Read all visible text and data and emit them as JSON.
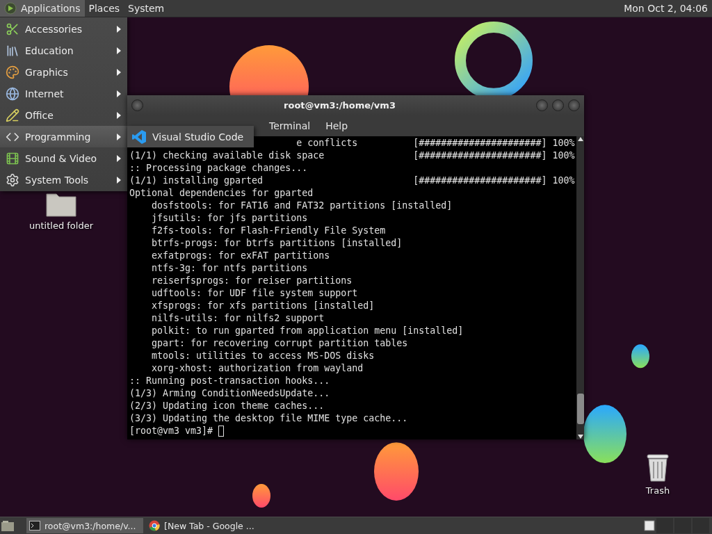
{
  "top_panel": {
    "menus": [
      {
        "label": "Applications",
        "selected": true
      },
      {
        "label": "Places",
        "selected": false
      },
      {
        "label": "System",
        "selected": false
      }
    ],
    "clock": "Mon Oct 2, 04:06"
  },
  "applications_menu": {
    "items": [
      {
        "label": "Accessories",
        "selected": false
      },
      {
        "label": "Education",
        "selected": false
      },
      {
        "label": "Graphics",
        "selected": false
      },
      {
        "label": "Internet",
        "selected": false
      },
      {
        "label": "Office",
        "selected": false
      },
      {
        "label": "Programming",
        "selected": true
      },
      {
        "label": "Sound & Video",
        "selected": false
      },
      {
        "label": "System Tools",
        "selected": false
      }
    ]
  },
  "submenu": {
    "items": [
      {
        "label": "Visual Studio Code"
      }
    ]
  },
  "desktop_icons": [
    {
      "label": "untitled folder",
      "kind": "folder"
    },
    {
      "label": "Trash",
      "kind": "trash"
    }
  ],
  "terminal": {
    "title": "root@vm3:/home/vm3",
    "menus": [
      "Terminal",
      "Help"
    ],
    "lines": [
      {
        "text": "e conflicts",
        "kind": "partial",
        "progress": "[######################] 100%"
      },
      {
        "text": "(1/1) checking available disk space",
        "progress": "[######################] 100%"
      },
      {
        "text": ":: Processing package changes..."
      },
      {
        "text": "(1/1) installing gparted",
        "progress": "[######################] 100%"
      },
      {
        "text": "Optional dependencies for gparted",
        "children": [
          {
            "text": "dosfstools: for FAT16 and FAT32 partitions [installed]"
          },
          {
            "text": "jfsutils: for jfs partitions"
          },
          {
            "text": "f2fs-tools: for Flash-Friendly File System"
          },
          {
            "text": "btrfs-progs: for btrfs partitions [installed]"
          },
          {
            "text": "exfatprogs: for exFAT partitions"
          },
          {
            "text": "ntfs-3g: for ntfs partitions"
          },
          {
            "text": "reiserfsprogs: for reiser partitions"
          },
          {
            "text": "udftools: for UDF file system support"
          },
          {
            "text": "xfsprogs: for xfs partitions [installed]"
          },
          {
            "text": "nilfs-utils: for nilfs2 support"
          },
          {
            "text": "polkit: to run gparted from application menu [installed]"
          },
          {
            "text": "gpart: for recovering corrupt partition tables"
          },
          {
            "text": "mtools: utilities to access MS-DOS disks"
          },
          {
            "text": "xorg-xhost: authorization from wayland"
          }
        ]
      },
      {
        "text": ":: Running post-transaction hooks..."
      },
      {
        "text": "(1/3) Arming ConditionNeedsUpdate..."
      },
      {
        "text": "(2/3) Updating icon theme caches..."
      },
      {
        "text": "(3/3) Updating the desktop file MIME type cache..."
      }
    ],
    "prompt": "[root@vm3 vm3]#"
  },
  "taskbar": {
    "tasks": [
      {
        "label": "root@vm3:/home/v...",
        "kind": "terminal",
        "selected": true
      },
      {
        "label": "[New Tab - Google ...",
        "kind": "browser",
        "selected": false
      }
    ]
  }
}
